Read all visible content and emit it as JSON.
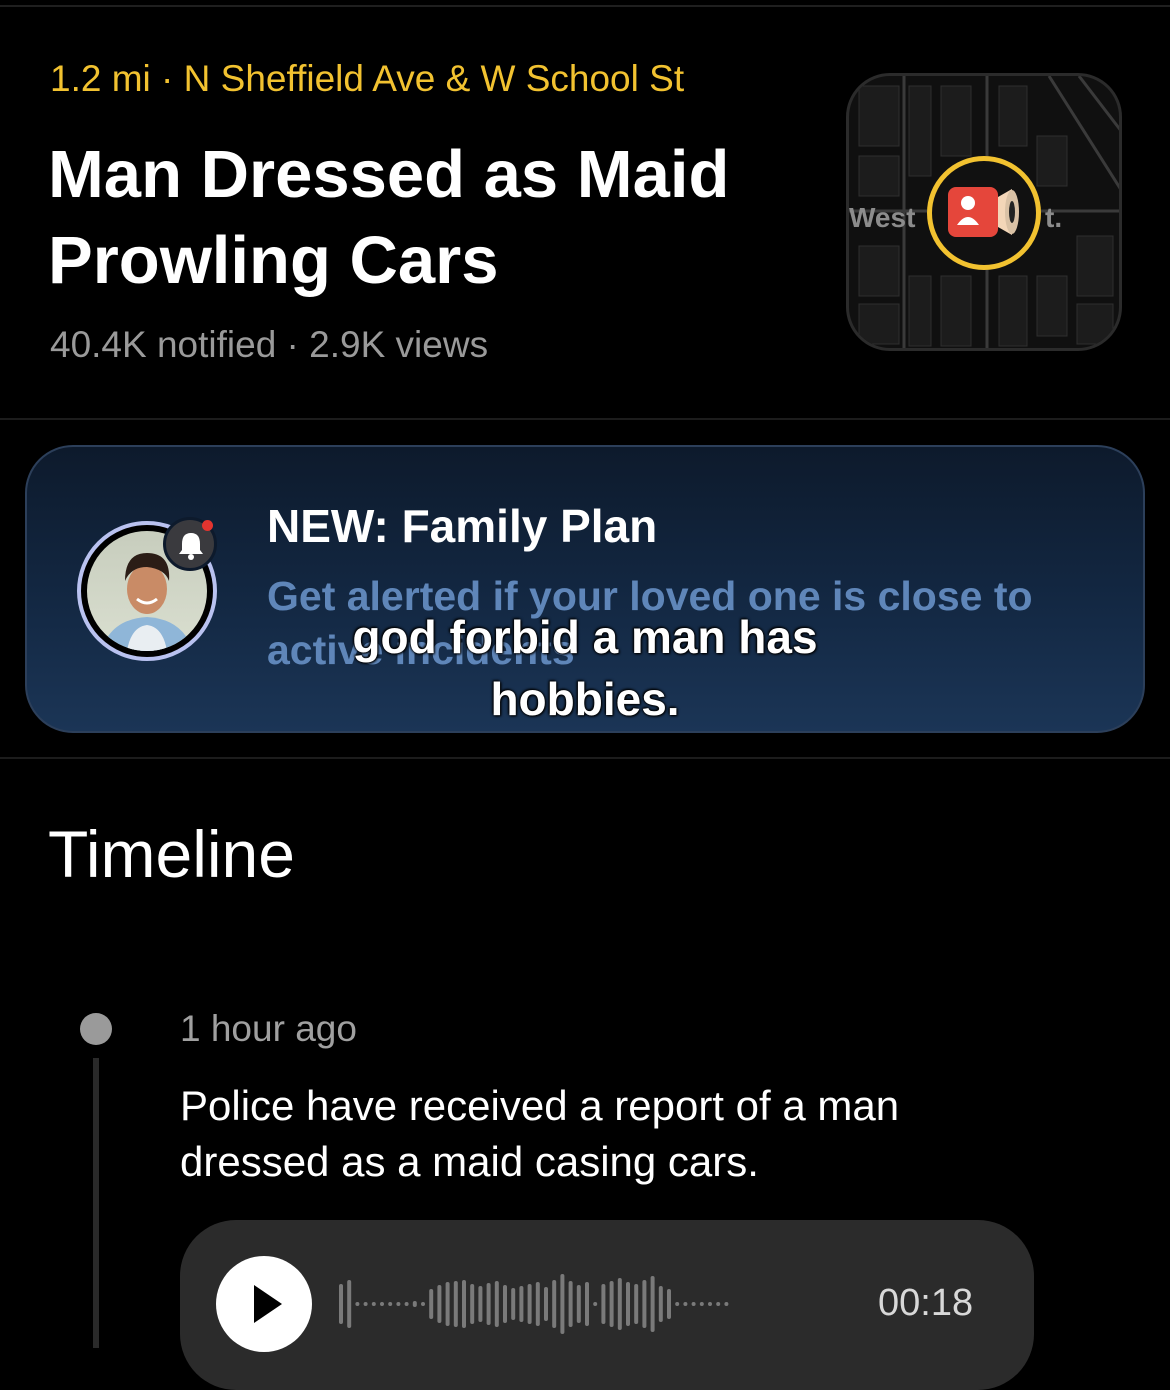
{
  "incident": {
    "location": "1.2 mi · N Sheffield Ave & W School St",
    "title": "Man Dressed as Maid Prowling Cars",
    "stats": "40.4K notified · 2.9K views"
  },
  "map": {
    "label_left": "West",
    "label_right": "t.",
    "marker_icon": "speaker-alert-icon",
    "marker_color": "#f2c230"
  },
  "promo": {
    "title": "NEW: Family Plan",
    "subtitle": "Get alerted if your loved one is close to active incidents",
    "badge_icon": "bell-icon"
  },
  "caption": "god forbid a man has hobbies.",
  "timeline": {
    "heading": "Timeline",
    "entries": [
      {
        "time": "1 hour ago",
        "text": "Police have received a report of a man dressed as a maid casing cars.",
        "audio_duration": "00:18"
      }
    ]
  },
  "colors": {
    "accent": "#f2c230",
    "promo_subtitle": "#5f86b9",
    "background": "#000000"
  }
}
